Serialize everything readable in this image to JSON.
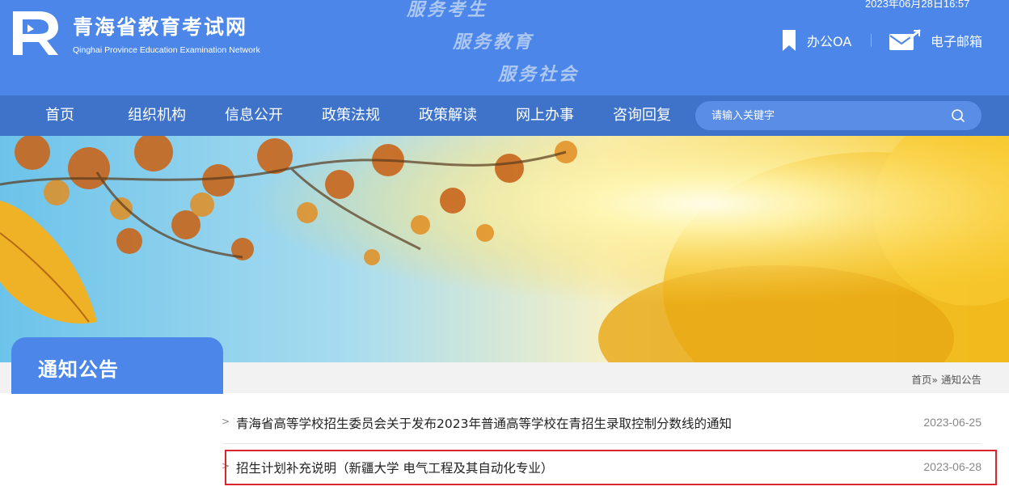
{
  "header": {
    "site_title": "青海省教育考试网",
    "site_subtitle": "Qinghai Province Education Examination Network",
    "slogans": [
      "服务考生",
      "服务教育",
      "服务社会"
    ],
    "datetime": "2023年06月28日16:57",
    "links": [
      {
        "label": "办公OA",
        "icon": "bookmark-icon"
      },
      {
        "label": "电子邮箱",
        "icon": "mail-icon"
      }
    ]
  },
  "nav": {
    "items": [
      "首页",
      "组织机构",
      "信息公开",
      "政策法规",
      "政策解读",
      "网上办事",
      "咨询回复"
    ],
    "search_placeholder": "请输入关键字",
    "search_icon": "search-icon"
  },
  "section": {
    "title": "通知公告",
    "breadcrumb": "首页» 通知公告"
  },
  "news": [
    {
      "title": "青海省高等学校招生委员会关于发布2023年普通高等学校在青招生录取控制分数线的通知",
      "date": "2023-06-25"
    },
    {
      "title": "招生计划补充说明（新疆大学 电气工程及其自动化专业）",
      "date": "2023-06-28"
    }
  ],
  "colors": {
    "header_bg": "#4b86e8",
    "nav_bg": "#3f73c9",
    "highlight_border": "#d9262c"
  }
}
